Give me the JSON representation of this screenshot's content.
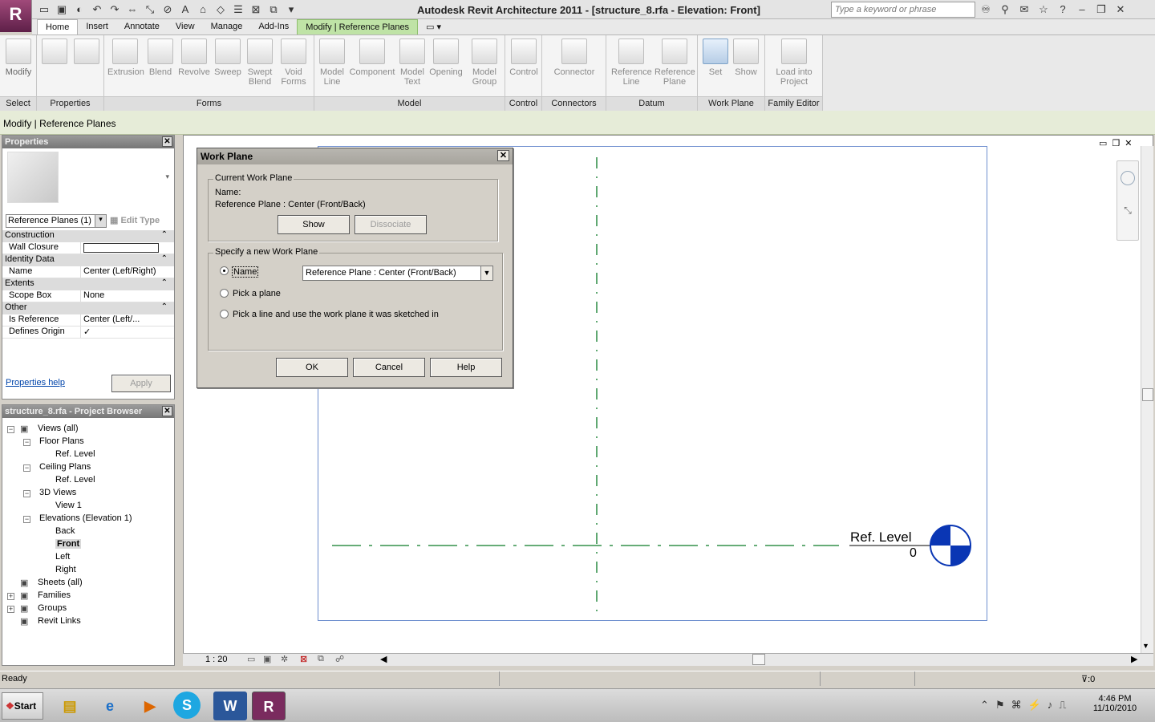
{
  "app": {
    "title": "Autodesk Revit Architecture 2011 - [structure_8.rfa - Elevation: Front]",
    "logo_letter": "R",
    "search_placeholder": "Type a keyword or phrase"
  },
  "tabs": [
    "Home",
    "Insert",
    "Annotate",
    "View",
    "Manage",
    "Add-Ins",
    "Modify | Reference Planes"
  ],
  "ribbon": {
    "panels": [
      {
        "label": "Select",
        "buttons": [
          "Modify"
        ]
      },
      {
        "label": "Properties",
        "buttons": []
      },
      {
        "label": "Forms",
        "buttons": [
          "Extrusion",
          "Blend",
          "Revolve",
          "Sweep",
          "Swept Blend",
          "Void Forms"
        ]
      },
      {
        "label": "Model",
        "buttons": [
          "Model Line",
          "Component",
          "Model Text",
          "Opening",
          "Model Group"
        ]
      },
      {
        "label": "Control",
        "buttons": [
          "Control"
        ]
      },
      {
        "label": "Connectors",
        "buttons": [
          "Connector"
        ]
      },
      {
        "label": "Datum",
        "buttons": [
          "Reference Line",
          "Reference Plane"
        ]
      },
      {
        "label": "Work Plane",
        "buttons": [
          "Set",
          "Show"
        ]
      },
      {
        "label": "Family Editor",
        "buttons": [
          "Load into Project"
        ]
      }
    ]
  },
  "options_bar": {
    "text": "Modify | Reference Planes"
  },
  "properties": {
    "title": "Properties",
    "type_selector": "Reference Planes (1)",
    "edit_type": "Edit Type",
    "rows": [
      {
        "section": "Construction"
      },
      {
        "k": "Wall Closure",
        "v": ""
      },
      {
        "section": "Identity Data"
      },
      {
        "k": "Name",
        "v": "Center (Left/Right)"
      },
      {
        "section": "Extents"
      },
      {
        "k": "Scope Box",
        "v": "None"
      },
      {
        "section": "Other"
      },
      {
        "k": "Is Reference",
        "v": "Center (Left/..."
      },
      {
        "k": "Defines Origin",
        "v": "✓"
      }
    ],
    "help_link": "Properties help",
    "apply": "Apply"
  },
  "browser": {
    "title": "structure_8.rfa - Project Browser",
    "items": [
      {
        "label": "Views (all)",
        "level": 0,
        "toggle": "−"
      },
      {
        "label": "Floor Plans",
        "level": 1,
        "toggle": "−"
      },
      {
        "label": "Ref. Level",
        "level": 2
      },
      {
        "label": "Ceiling Plans",
        "level": 1,
        "toggle": "−"
      },
      {
        "label": "Ref. Level",
        "level": 2
      },
      {
        "label": "3D Views",
        "level": 1,
        "toggle": "−"
      },
      {
        "label": "View 1",
        "level": 2
      },
      {
        "label": "Elevations (Elevation 1)",
        "level": 1,
        "toggle": "−"
      },
      {
        "label": "Back",
        "level": 2
      },
      {
        "label": "Front",
        "level": 2,
        "selected": true
      },
      {
        "label": "Left",
        "level": 2
      },
      {
        "label": "Right",
        "level": 2
      },
      {
        "label": "Sheets (all)",
        "level": 0
      },
      {
        "label": "Families",
        "level": 0,
        "toggle": "+"
      },
      {
        "label": "Groups",
        "level": 0,
        "toggle": "+"
      },
      {
        "label": "Revit Links",
        "level": 0
      }
    ]
  },
  "canvas": {
    "level_name": "Ref. Level",
    "level_value": "0",
    "scale": "1 : 20",
    "accent_color": "#0a36b4",
    "refplane_color": "#0b7a26"
  },
  "dialog": {
    "title": "Work Plane",
    "current_group": "Current Work Plane",
    "name_label": "Name:",
    "current_value": "Reference Plane : Center (Front/Back)",
    "show": "Show",
    "dissociate": "Dissociate",
    "specify_group": "Specify a new Work Plane",
    "opt_name": "Name",
    "name_select": "Reference Plane : Center (Front/Back)",
    "opt_pick_plane": "Pick a plane",
    "opt_pick_line": "Pick a line and use the work plane it was sketched in",
    "ok": "OK",
    "cancel": "Cancel",
    "help": "Help"
  },
  "status": {
    "text": "Ready",
    "filter": ":0"
  },
  "taskbar": {
    "start": "Start",
    "time": "4:46 PM",
    "date": "11/10/2010"
  }
}
